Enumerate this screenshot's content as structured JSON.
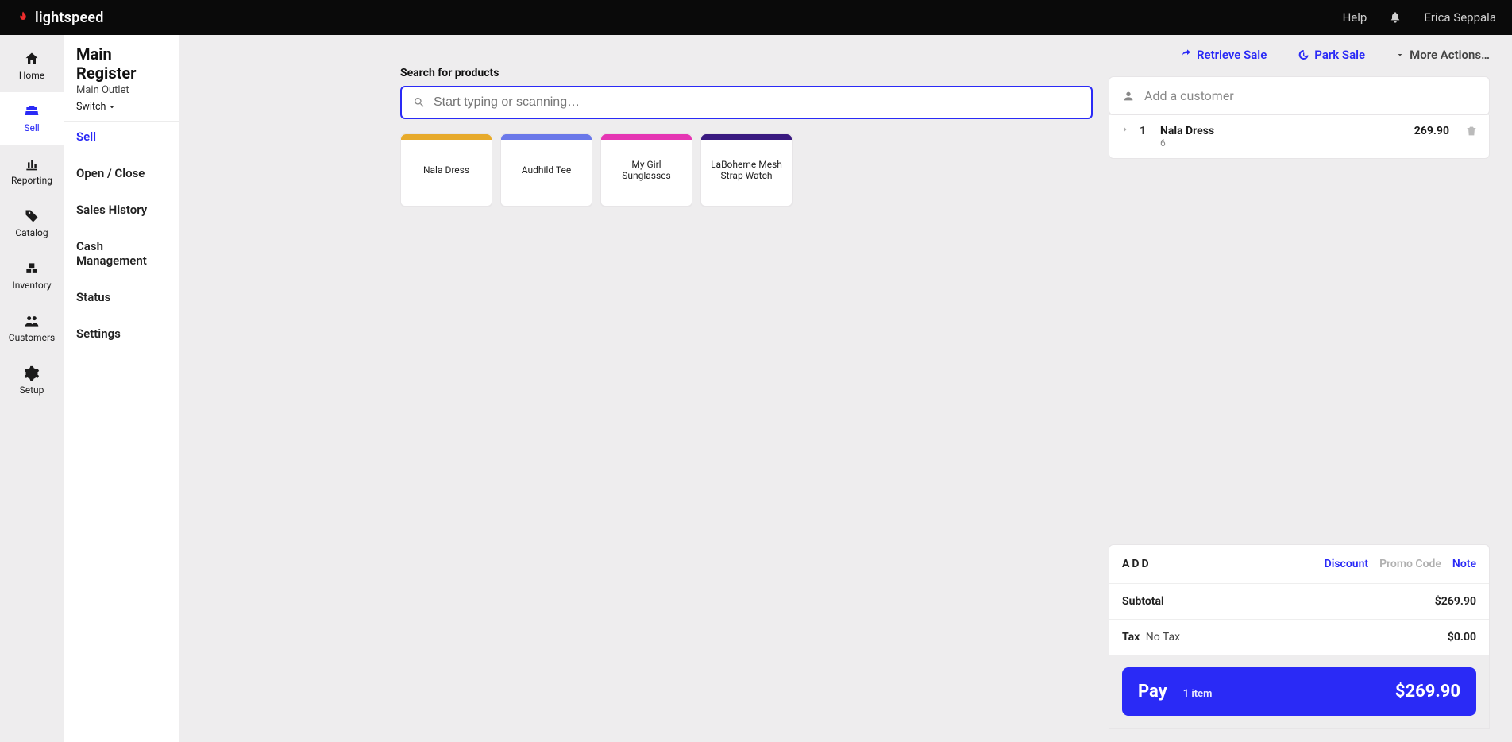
{
  "brand": {
    "name": "lightspeed"
  },
  "topbar": {
    "help": "Help",
    "user": "Erica Seppala"
  },
  "rail": [
    {
      "id": "home",
      "label": "Home"
    },
    {
      "id": "sell",
      "label": "Sell"
    },
    {
      "id": "reporting",
      "label": "Reporting"
    },
    {
      "id": "catalog",
      "label": "Catalog"
    },
    {
      "id": "inventory",
      "label": "Inventory"
    },
    {
      "id": "customers",
      "label": "Customers"
    },
    {
      "id": "setup",
      "label": "Setup"
    }
  ],
  "secondary": {
    "title": "Main Register",
    "subtitle": "Main Outlet",
    "switch": "Switch",
    "items": [
      {
        "label": "Sell",
        "active": true
      },
      {
        "label": "Open / Close"
      },
      {
        "label": "Sales History"
      },
      {
        "label": "Cash Management"
      },
      {
        "label": "Status"
      },
      {
        "label": "Settings"
      }
    ]
  },
  "actions": {
    "retrieve": "Retrieve Sale",
    "park": "Park Sale",
    "more": "More Actions…"
  },
  "search": {
    "label": "Search for products",
    "placeholder": "Start typing or scanning…"
  },
  "tiles": [
    {
      "label": "Nala Dress"
    },
    {
      "label": "Audhild Tee"
    },
    {
      "label": "My Girl Sunglasses"
    },
    {
      "label": "LaBoheme Mesh Strap Watch"
    }
  ],
  "cart": {
    "customer_placeholder": "Add a customer",
    "lines": [
      {
        "qty": "1",
        "name": "Nala Dress",
        "sub": "6",
        "price": "269.90"
      }
    ],
    "add": {
      "label": "ADD",
      "discount": "Discount",
      "promo": "Promo Code",
      "note": "Note"
    },
    "subtotal": {
      "label": "Subtotal",
      "value": "$269.90"
    },
    "tax": {
      "label": "Tax",
      "name": "No Tax",
      "value": "$0.00"
    },
    "pay": {
      "label": "Pay",
      "items": "1 item",
      "total": "$269.90"
    }
  }
}
